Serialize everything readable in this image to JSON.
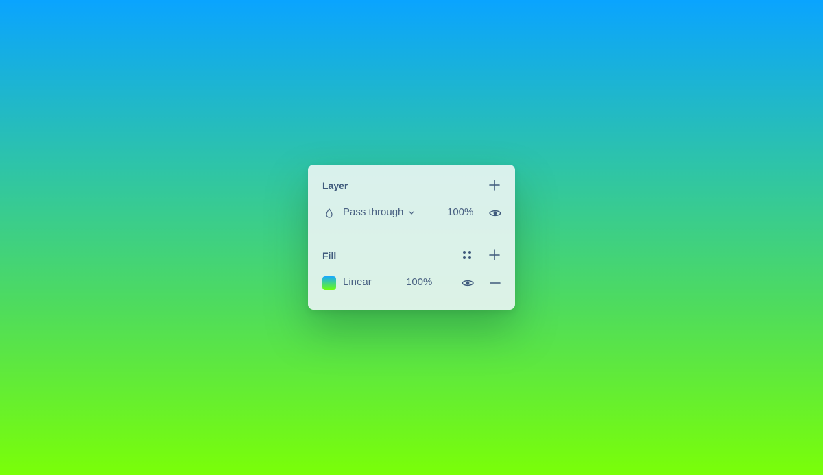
{
  "layer": {
    "title": "Layer",
    "blend_mode": "Pass through",
    "opacity": "100%",
    "icons": {
      "add": "plus-icon",
      "blend": "droplet-icon",
      "dropdown": "chevron-down-icon",
      "visibility": "eye-icon"
    }
  },
  "fill": {
    "title": "Fill",
    "type": "Linear",
    "opacity": "100%",
    "swatch_colors": [
      "#18a8ff",
      "#6eff0c"
    ],
    "icons": {
      "styles": "four-dots-icon",
      "add": "plus-icon",
      "visibility": "eye-icon",
      "remove": "minus-icon"
    }
  },
  "colors": {
    "background_top": "#0aa4ff",
    "background_bottom": "#7aff08",
    "text": "#3b5578"
  }
}
